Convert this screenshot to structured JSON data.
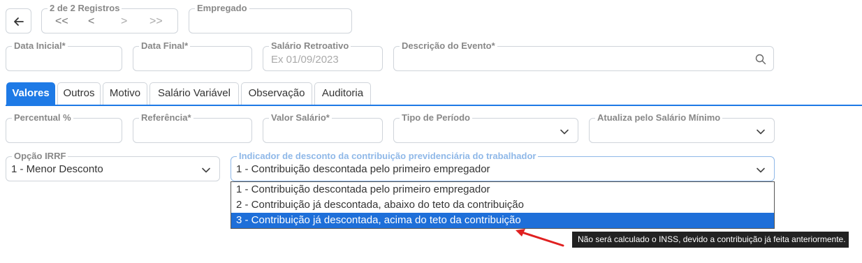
{
  "header": {
    "back_icon": "arrow-left-icon",
    "records_label": "2 de 2 Registros",
    "nav": [
      "<<",
      "<",
      ">",
      ">>"
    ],
    "employee_label": "Empregado"
  },
  "row1": {
    "data_inicial": "Data Inicial*",
    "data_final": "Data Final*",
    "salario_retroativo": "Salário Retroativo",
    "salario_retroativo_placeholder": "Ex 01/09/2023",
    "descricao_evento": "Descrição do Evento*"
  },
  "tabs": [
    "Valores",
    "Outros",
    "Motivo",
    "Salário Variável",
    "Observação",
    "Auditoria"
  ],
  "row2": {
    "percentual": "Percentual %",
    "referencia": "Referência*",
    "valor_salario": "Valor Salário*",
    "tipo_periodo": "Tipo de Período",
    "atualiza_salario": "Atualiza pelo Salário Mínimo"
  },
  "row3": {
    "opcao_irrf_label": "Opção IRRF",
    "opcao_irrf_value": "1 - Menor Desconto",
    "indicador_label": "Indicador de desconto da contribuição previdenciária do trabalhador",
    "indicador_value": "1 - Contribuição descontada pelo primeiro empregador"
  },
  "dropdown": {
    "options": [
      "1 - Contribuição descontada pelo primeiro empregador",
      "2 - Contribuição já descontada, abaixo do teto da contribuição",
      "3 - Contribuição já descontada, acima do teto da contribuição"
    ],
    "selected_index": 2
  },
  "tooltip": "Não será calculado o INSS, devido a contribuição já feita anteriormente.",
  "colors": {
    "accent": "#1e7ae6",
    "arrow": "#e02020"
  }
}
